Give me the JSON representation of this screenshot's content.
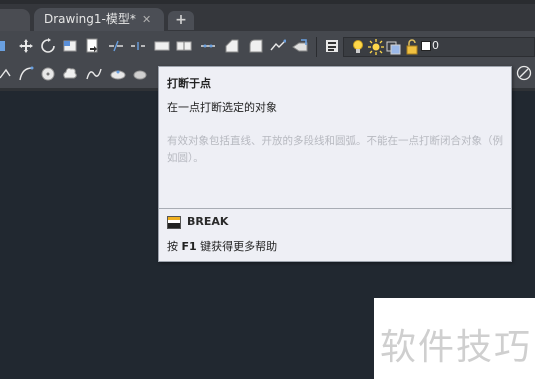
{
  "tabs": {
    "active_label": "Drawing1-模型*",
    "close_glyph": "✕",
    "add_glyph": "+"
  },
  "toolbar": {
    "layer_value": "0",
    "row1_icons": [
      "move-icon",
      "rotate-icon",
      "trim-icon",
      "copy-icon",
      "break-at-point-icon",
      "break-icon",
      "join-icon",
      "rectangle-icon",
      "explode-icon",
      "fillet-icon",
      "chamfer-icon",
      "stretch-icon",
      "match-properties-icon",
      "layer-properties-icon",
      "lightbulb-icon",
      "sun-icon",
      "layer-freeze-icon",
      "lock-icon",
      "color-square-icon"
    ],
    "row2_icons": [
      "polyline-icon",
      "arc-icon",
      "circle-icon",
      "cloud-icon",
      "spline-icon",
      "ellipse-icon",
      "hatch-icon",
      "orbit-icon"
    ]
  },
  "tooltip": {
    "title": "打断于点",
    "description": "在一点打断选定的对象",
    "detail": "有效对象包括直线、开放的多段线和圆弧。不能在一点打断闭合对象（例如圆）。",
    "command": "BREAK",
    "help_prefix": "按 ",
    "help_key": "F1",
    "help_suffix": " 键获得更多帮助"
  },
  "watermark": {
    "text": "软件技巧"
  }
}
